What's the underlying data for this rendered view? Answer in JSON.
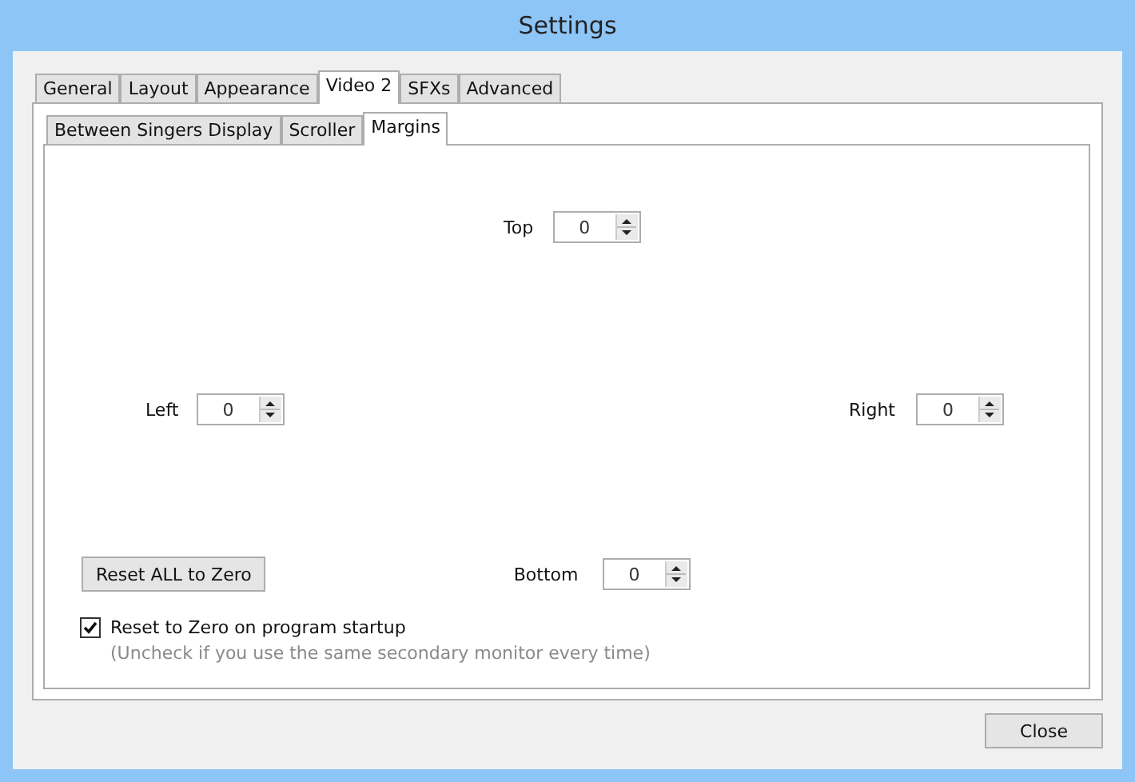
{
  "window": {
    "title": "Settings"
  },
  "tabs": [
    {
      "label": "General",
      "selected": false
    },
    {
      "label": "Layout",
      "selected": false
    },
    {
      "label": "Appearance",
      "selected": false
    },
    {
      "label": "Video 2",
      "selected": true
    },
    {
      "label": "SFXs",
      "selected": false
    },
    {
      "label": "Advanced",
      "selected": false
    }
  ],
  "subtabs": [
    {
      "label": "Between Singers Display",
      "selected": false
    },
    {
      "label": "Scroller",
      "selected": false
    },
    {
      "label": "Margins",
      "selected": true
    }
  ],
  "margins": {
    "top": {
      "label": "Top",
      "value": "0"
    },
    "left": {
      "label": "Left",
      "value": "0"
    },
    "right": {
      "label": "Right",
      "value": "0"
    },
    "bottom": {
      "label": "Bottom",
      "value": "0"
    }
  },
  "reset_button": "Reset ALL to Zero",
  "startup_checkbox": {
    "label": "Reset to Zero on program startup",
    "checked": true,
    "note": "(Uncheck if you use the same secondary monitor every time)"
  },
  "buttons": [
    "Close"
  ]
}
